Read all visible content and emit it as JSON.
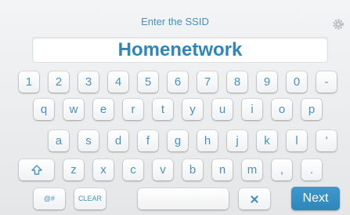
{
  "header": {
    "title": "Enter the SSID",
    "settings_icon": "gear-icon"
  },
  "input": {
    "value": "Homenetwork"
  },
  "keyboard": {
    "row1": [
      "1",
      "2",
      "3",
      "4",
      "5",
      "6",
      "7",
      "8",
      "9",
      "0",
      "-"
    ],
    "row2": [
      "q",
      "w",
      "e",
      "r",
      "t",
      "y",
      "u",
      "i",
      "o",
      "p"
    ],
    "row3": [
      "a",
      "s",
      "d",
      "f",
      "g",
      "h",
      "j",
      "k",
      "l",
      "'"
    ],
    "row4_letters": [
      "z",
      "x",
      "c",
      "v",
      "b",
      "n",
      "m",
      ",",
      "."
    ],
    "shift_icon": "shift-arrow-icon",
    "symbols_label": "@#",
    "clear_label": "CLEAR",
    "backspace_icon": "delete-x-icon",
    "next_label": "Next"
  },
  "colors": {
    "accent": "#2f86b9",
    "key_text": "#4a92c3",
    "next_bg": "#2f86b9"
  }
}
